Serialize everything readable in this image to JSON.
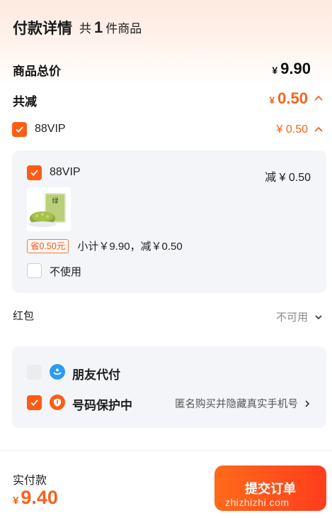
{
  "header": {
    "title": "付款详情",
    "count_prefix": "共",
    "count": "1",
    "count_suffix": "件商品"
  },
  "summary": {
    "total_label": "商品总价",
    "total_currency": "¥",
    "total_value": "9.90",
    "discount_label": "共减",
    "discount_currency": "¥",
    "discount_value": "0.50"
  },
  "vip": {
    "label": "88VIP",
    "amount": "¥ 0.50",
    "checked": true
  },
  "vip_panel": {
    "label": "88VIP",
    "discount_text": "减 ¥ 0.50",
    "saving_tag": "省0.50元",
    "subtotal_text": "小计￥9.90，减￥0.50",
    "not_use_label": "不使用"
  },
  "red_packet": {
    "label": "红包",
    "status": "不可用"
  },
  "options": {
    "friend_pay_label": "朋友代付",
    "number_protect_label": "号码保护中",
    "number_protect_desc": "匿名购买并隐藏真实手机号"
  },
  "footer": {
    "actual_label": "实付款",
    "currency": "¥",
    "actual_value": "9.40",
    "submit_label": "提交订单",
    "watermark": "zhizhizhi.com"
  },
  "colors": {
    "accent": "#ff5b14",
    "price_orange": "#f5621e"
  }
}
